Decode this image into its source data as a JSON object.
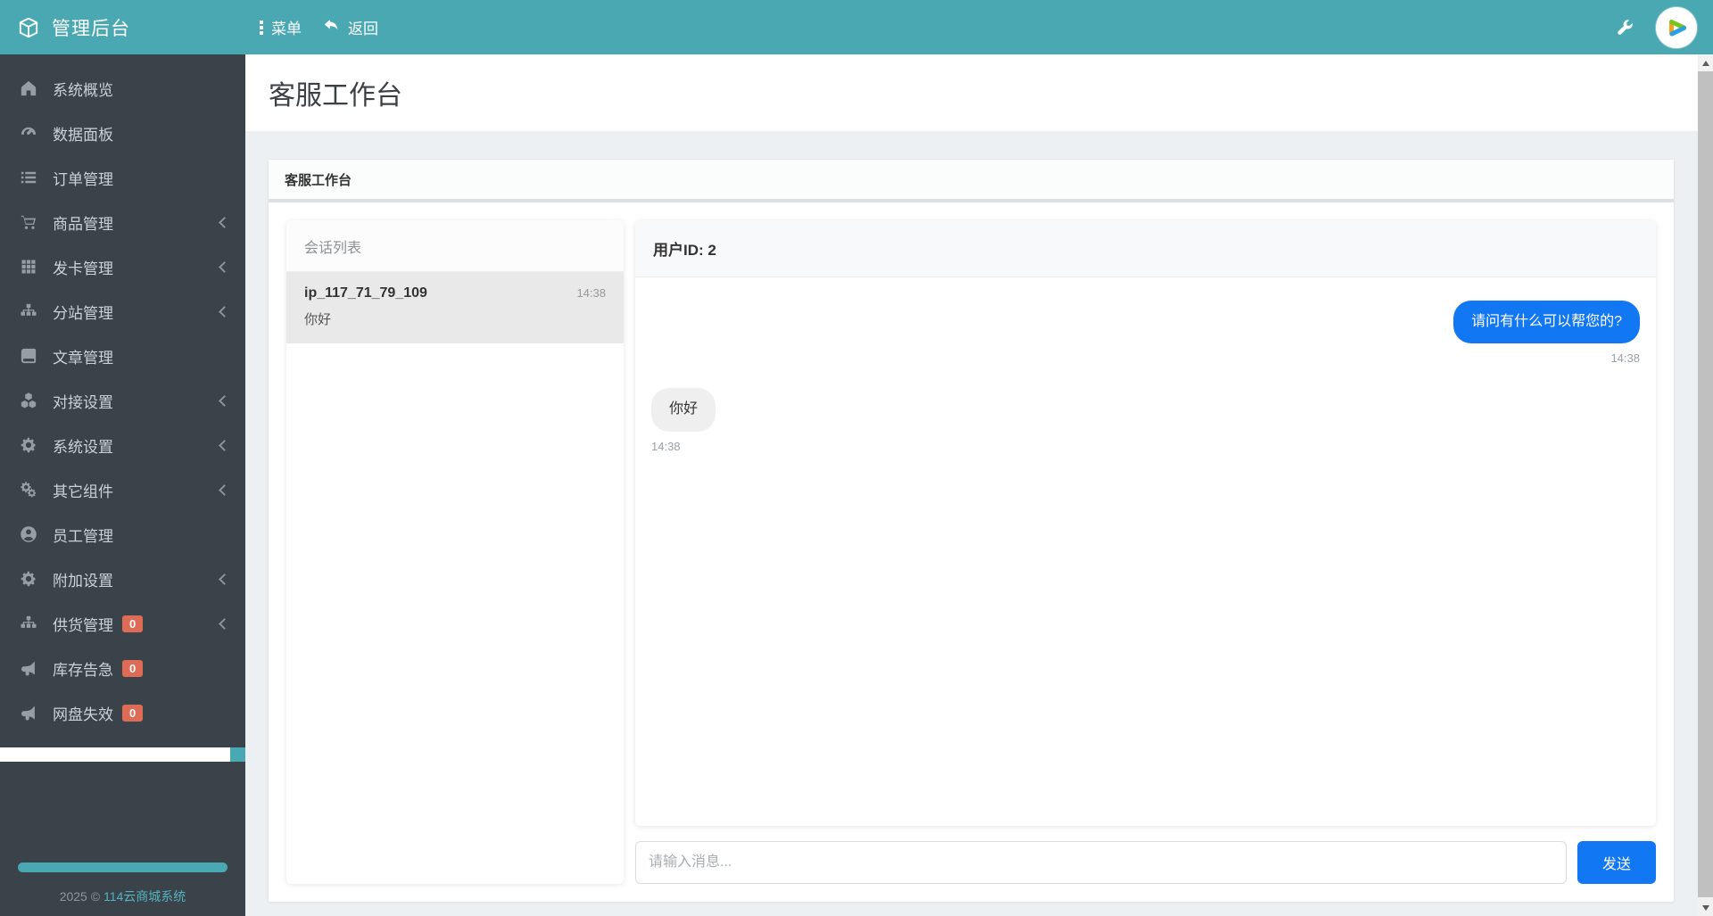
{
  "colors": {
    "accent": "#1277f2",
    "teal": "#4AA8B2",
    "sidebar": "#3A434A",
    "badge": "#DD6B55"
  },
  "topbar": {
    "brand": "管理后台",
    "menu_label": "菜单",
    "back_label": "返回"
  },
  "sidebar": {
    "items": [
      {
        "label": "系统概览",
        "icon": "home",
        "chevron": false,
        "badge": null
      },
      {
        "label": "数据面板",
        "icon": "gauge",
        "chevron": false,
        "badge": null
      },
      {
        "label": "订单管理",
        "icon": "list",
        "chevron": false,
        "badge": null
      },
      {
        "label": "商品管理",
        "icon": "cart",
        "chevron": true,
        "badge": null
      },
      {
        "label": "发卡管理",
        "icon": "grid",
        "chevron": true,
        "badge": null
      },
      {
        "label": "分站管理",
        "icon": "sitemap",
        "chevron": true,
        "badge": null
      },
      {
        "label": "文章管理",
        "icon": "book",
        "chevron": false,
        "badge": null
      },
      {
        "label": "对接设置",
        "icon": "cubes",
        "chevron": true,
        "badge": null
      },
      {
        "label": "系统设置",
        "icon": "gear",
        "chevron": true,
        "badge": null
      },
      {
        "label": "其它组件",
        "icon": "cogs",
        "chevron": true,
        "badge": null
      },
      {
        "label": "员工管理",
        "icon": "user",
        "chevron": false,
        "badge": null
      },
      {
        "label": "附加设置",
        "icon": "gear",
        "chevron": true,
        "badge": null
      },
      {
        "label": "供货管理",
        "icon": "sitemap",
        "chevron": true,
        "badge": "0"
      },
      {
        "label": "库存告急",
        "icon": "bullhorn",
        "chevron": false,
        "badge": "0"
      },
      {
        "label": "网盘失效",
        "icon": "bullhorn",
        "chevron": false,
        "badge": "0"
      }
    ],
    "copyright_prefix": "2025 © ",
    "copyright_link": "114云商城系统"
  },
  "page": {
    "title": "客服工作台",
    "panel_title": "客服工作台"
  },
  "chat": {
    "list_title": "会话列表",
    "conversations": [
      {
        "name": "ip_117_71_79_109",
        "time": "14:38",
        "preview": "你好"
      }
    ],
    "header": "用户ID: 2",
    "messages": [
      {
        "side": "right",
        "text": "请问有什么可以帮您的?",
        "time": "14:38"
      },
      {
        "side": "left",
        "text": "你好",
        "time": "14:38"
      }
    ],
    "input_placeholder": "请输入消息...",
    "send_label": "发送"
  }
}
